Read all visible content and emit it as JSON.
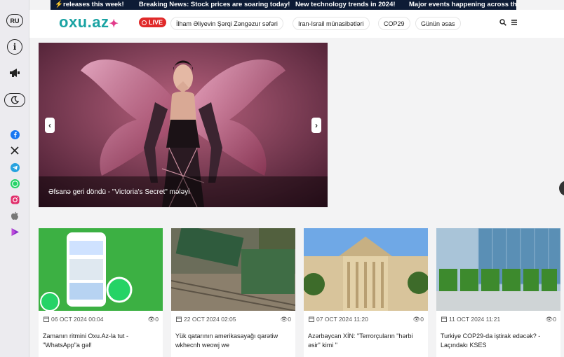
{
  "ticker": {
    "items": [
      "releases this week!",
      "Breaking News: Stock prices are soaring today!",
      "New technology trends in 2024!",
      "Major events happening across the"
    ]
  },
  "sidebar": {
    "lang": "RU",
    "info": "i",
    "social": [
      "facebook-icon",
      "x-icon",
      "telegram-icon",
      "whatsapp-icon",
      "instagram-icon",
      "apple-icon",
      "play-store-icon"
    ]
  },
  "header": {
    "logo_text": "oxu.az",
    "live_label": "LIVE",
    "nav": [
      "İlham Əliyevin Şərqi Zəngəzur səfəri",
      "Iran-Israil münasibətləri",
      "COP29",
      "Günün əsas"
    ]
  },
  "slider": {
    "caption": "Əfsanə geri döndü - \"Victoria's Secret\" mələyi",
    "prev": "‹",
    "next": "›"
  },
  "cards": [
    {
      "date": "06 OCT 2024 00:04",
      "views": "0",
      "title": "Zamanın ritmini Oxu.Az-la tut - \"WhatsApp\"a gəl!"
    },
    {
      "date": "22 OCT 2024 02:05",
      "views": "0",
      "title": "Yük qatarının amerikasayağı qarətiw wkhecnh weowj we"
    },
    {
      "date": "07 OCT 2024 11:20",
      "views": "0",
      "title": "Azərbaycan XİN: \"Terrorçuların \"hərbi əsir\" kimi \""
    },
    {
      "date": "11 OCT 2024 11:21",
      "views": "0",
      "title": "Turkiye COP29-da iştirak edəcək? - Laçındakı KSES"
    }
  ],
  "colors": {
    "ticker_bg": "#0d1b35",
    "logo": "#1aa3a3",
    "live": "#e02a2a"
  }
}
